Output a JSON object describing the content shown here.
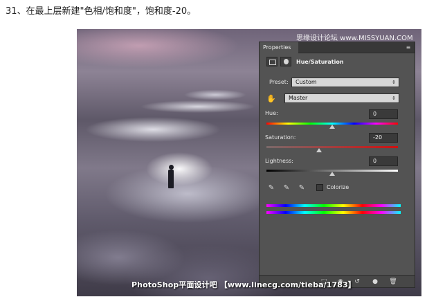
{
  "caption": "31、在最上层新建\"色相/饱和度\"，饱和度-20。",
  "watermark_top": "思缘设计论坛 www.MISSYUAN.COM",
  "watermark_bottom": "PhotoShop平面设计吧 【www.linecg.com/tieba/1783】",
  "panel": {
    "tab_label": "Properties",
    "menu_glyph": "≡",
    "title": "Hue/Saturation",
    "preset_label": "Preset:",
    "preset_value": "Custom",
    "channel_value": "Master",
    "chevron": "⇕",
    "hand_glyph": "✋",
    "hue_label": "Hue:",
    "hue_value": "0",
    "saturation_label": "Saturation:",
    "saturation_value": "-20",
    "lightness_label": "Lightness:",
    "lightness_value": "0",
    "eyedropper_glyph": "✎",
    "colorize_label": "Colorize",
    "colorize_checked": false,
    "footer_glyphs": {
      "clip": "⬚",
      "eye": "◉",
      "reset": "↺",
      "visibility": "●",
      "trash": "🗑"
    }
  },
  "sliders": {
    "hue": 0,
    "saturation": -20,
    "lightness": 0
  },
  "colors": {
    "panel_bg": "#535353",
    "tab_bar": "#383838",
    "text": "#e6e6e6"
  }
}
